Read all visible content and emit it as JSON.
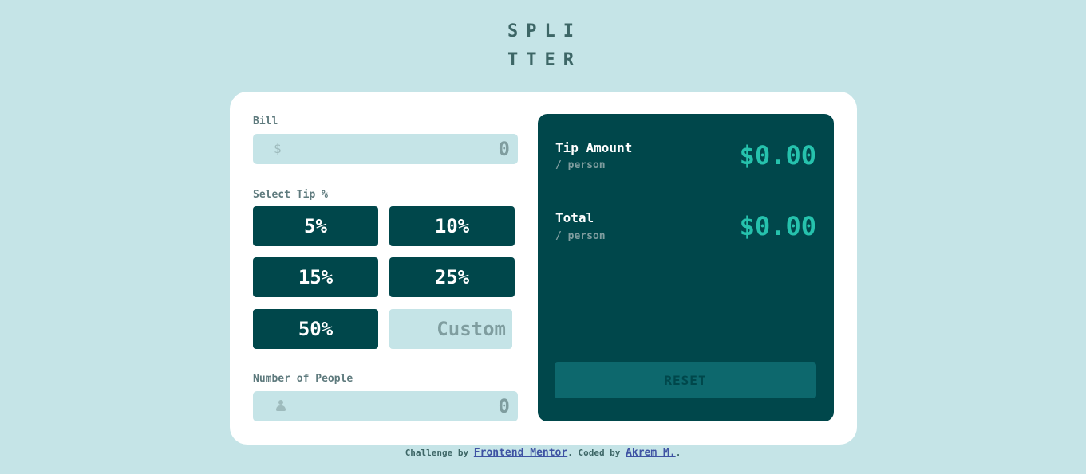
{
  "app": {
    "logo_line1": "SPLI",
    "logo_line2": "TTER"
  },
  "form": {
    "bill_label": "Bill",
    "bill_icon": "$",
    "bill_value": "0",
    "tip_label": "Select Tip %",
    "tips": [
      "5%",
      "10%",
      "15%",
      "25%",
      "50%"
    ],
    "custom_placeholder": "Custom",
    "people_label": "Number of People",
    "people_icon": "person-icon",
    "people_value": "0"
  },
  "results": {
    "tip_label": "Tip Amount",
    "tip_sub": "/ person",
    "tip_amount": "$0.00",
    "total_label": "Total",
    "total_sub": "/ person",
    "total_amount": "$0.00",
    "reset_label": "RESET"
  },
  "footer": {
    "prefix": "Challenge by",
    "link1": "Frontend Mentor",
    "middle": ". Coded by",
    "link2": "Akrem M.",
    "suffix": "."
  },
  "colors": {
    "background": "#c5e4e7",
    "dark_cyan": "#00474b",
    "accent": "#26c2ad",
    "white": "#ffffff"
  }
}
